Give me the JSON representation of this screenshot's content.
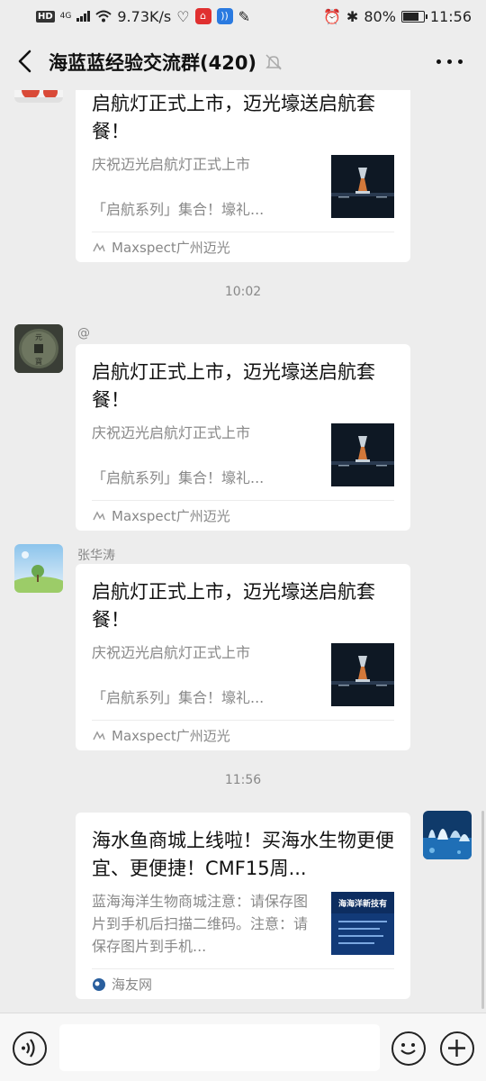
{
  "status": {
    "speed": "9.73K/s",
    "battery": "80%",
    "time": "11:56",
    "network": "4G",
    "hd": "HD"
  },
  "header": {
    "title": "海蓝蓝经验交流群(420)"
  },
  "messages": [
    {
      "sender": "",
      "title": "启航灯正式上市，迈光壕送启航套餐！",
      "desc_line1": "庆祝迈光启航灯正式上市",
      "desc_line2": "「启航系列」集合！壕礼...",
      "source": "Maxspect广州迈光"
    },
    {
      "time": "10:02"
    },
    {
      "sender": "@",
      "title": "启航灯正式上市，迈光壕送启航套餐！",
      "desc_line1": "庆祝迈光启航灯正式上市",
      "desc_line2": "「启航系列」集合！壕礼...",
      "source": "Maxspect广州迈光"
    },
    {
      "sender": "张华涛",
      "title": "启航灯正式上市，迈光壕送启航套餐！",
      "desc_line1": "庆祝迈光启航灯正式上市",
      "desc_line2": "「启航系列」集合！壕礼...",
      "source": "Maxspect广州迈光"
    },
    {
      "time": "11:56"
    },
    {
      "sender": "",
      "title": "海水鱼商城上线啦！买海水生物更便宜、更便捷！CMF15周...",
      "desc": "蓝海海洋生物商城注意：请保存图片到手机后扫描二维码。注意：请保存图片到手机...",
      "source": "海友网",
      "thumb_text": "海海洋新技有"
    }
  ],
  "colors": {
    "background": "#ededed",
    "card": "#ffffff",
    "muted_text": "#888888"
  }
}
